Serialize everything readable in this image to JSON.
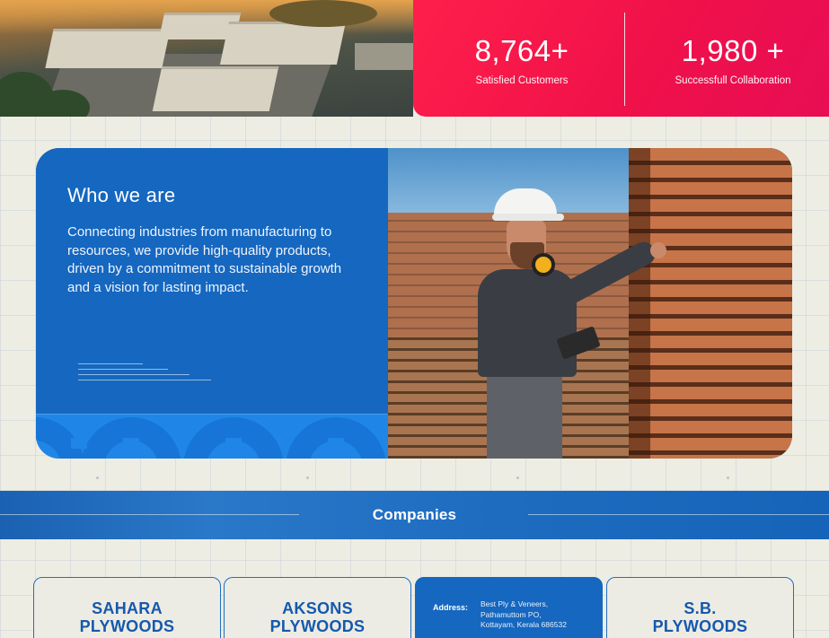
{
  "stats": {
    "items": [
      {
        "value": "8,764+",
        "label": "Satisfied Customers"
      },
      {
        "value": "1,980 +",
        "label": "Successfull Collaboration"
      }
    ]
  },
  "about": {
    "title": "Who we are",
    "text": "Connecting industries from manufacturing to resources, we provide high-quality products, driven by a commitment to sustainable growth and a vision for lasting impact."
  },
  "companies": {
    "title": "Companies",
    "cards": [
      {
        "name_line1": "SAHARA",
        "name_line2": "PLYWOODS"
      },
      {
        "name_line1": "AKSONS",
        "name_line2": "PLYWOODS"
      },
      {
        "address_label": "Address:",
        "address_line1": "Best Ply & Veneers,",
        "address_line2": "Pathamuttom PO,",
        "address_line3": "Kottayam, Kerala 686532"
      },
      {
        "name_line1": "S.B.",
        "name_line2": "PLYWOODS"
      }
    ]
  },
  "colors": {
    "accent_red": "#ff1f4b",
    "brand_blue": "#1567bf",
    "background": "#eeede3"
  }
}
